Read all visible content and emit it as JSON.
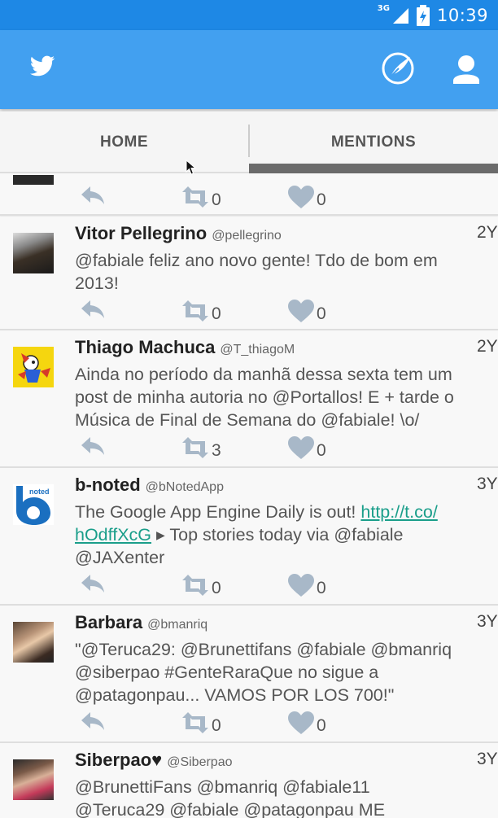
{
  "status": {
    "network": "3G",
    "time": "10:39"
  },
  "tabs": {
    "home": "HOME",
    "mentions": "MENTIONS"
  },
  "tweets": [
    {
      "name": "",
      "handle": "",
      "time": "",
      "lines": [
        ""
      ],
      "retweets": "0",
      "favorites": "0"
    },
    {
      "name": "Vitor Pellegrino",
      "handle": "@pellegrino",
      "time": "2Y",
      "lines": [
        "@fabiale feliz ano novo gente! Tdo de bom em",
        "2013!"
      ],
      "retweets": "0",
      "favorites": "0"
    },
    {
      "name": "Thiago Machuca",
      "handle": "@T_thiagoM",
      "time": "2Y",
      "lines": [
        "Ainda no período da manhã dessa sexta tem um",
        "post de minha autoria no @Portallos! E + tarde o",
        "Música de Final de Semana do @fabiale! \\o/"
      ],
      "retweets": "3",
      "favorites": "0"
    },
    {
      "name": "b-noted",
      "handle": "@bNotedApp",
      "time": "3Y",
      "line1_prefix": "The Google App Engine Daily is out! ",
      "link_part1": "http://t.co/",
      "link_part2": "hOdffXcG",
      "line2_suffix": " ▸ Top stories today via @fabiale",
      "line3": "@JAXenter",
      "retweets": "0",
      "favorites": "0"
    },
    {
      "name": "Barbara",
      "handle": "@bmanriq",
      "time": "3Y",
      "lines": [
        "\"@Teruca29: @Brunettifans @fabiale @bmanriq",
        "@siberpao #GenteRaraQue no sigue a",
        "@patagonpau... VAMOS POR LOS 700!\""
      ],
      "retweets": "0",
      "favorites": "0"
    },
    {
      "name": "Siberpao♥",
      "handle": "@Siberpao",
      "time": "3Y",
      "lines": [
        "@BrunettiFans @bmanriq @fabiale11",
        "@Teruca29 @fabiale @patagonpau ME"
      ],
      "retweets": "",
      "favorites": ""
    }
  ],
  "colors": {
    "statusbar": "#1e88e5",
    "appbar": "#42a0f0",
    "icon_grey": "#a8b8c8"
  }
}
